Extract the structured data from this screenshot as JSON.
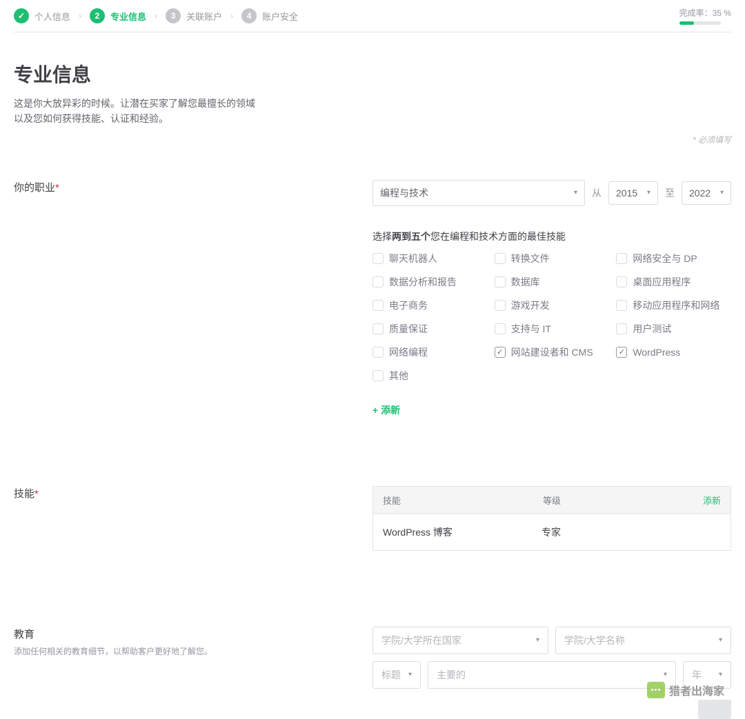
{
  "stepper": {
    "steps": [
      {
        "label": "个人信息",
        "state": "done",
        "num": "✓"
      },
      {
        "label": "专业信息",
        "state": "active",
        "num": "2"
      },
      {
        "label": "关联账户",
        "state": "idle",
        "num": "3"
      },
      {
        "label": "账户安全",
        "state": "idle",
        "num": "4"
      }
    ],
    "progress_label": "完成率：35 %",
    "progress_pct": 35
  },
  "header": {
    "title": "专业信息",
    "desc": "这是你大放异彩的时候。让潜在买家了解您最擅长的领域以及您如何获得技能、认证和经验。",
    "required_note": "* 必须填写"
  },
  "occupation": {
    "label": "你的职业",
    "select_value": "编程与技术",
    "from_label": "从",
    "from_value": "2015",
    "to_label": "至",
    "to_value": "2022",
    "skills_prompt_pre": "选择",
    "skills_prompt_bold": "两到五个",
    "skills_prompt_post": "您在编程和技术方面的最佳技能",
    "skills": [
      {
        "label": "聊天机器人",
        "checked": false
      },
      {
        "label": "转换文件",
        "checked": false
      },
      {
        "label": "网络安全与 DP",
        "checked": false
      },
      {
        "label": "数据分析和报告",
        "checked": false
      },
      {
        "label": "数据库",
        "checked": false
      },
      {
        "label": "桌面应用程序",
        "checked": false
      },
      {
        "label": "电子商务",
        "checked": false
      },
      {
        "label": "游戏开发",
        "checked": false
      },
      {
        "label": "移动应用程序和网络",
        "checked": false
      },
      {
        "label": "质量保证",
        "checked": false
      },
      {
        "label": "支持与 IT",
        "checked": false
      },
      {
        "label": "用户测试",
        "checked": false
      },
      {
        "label": "网络编程",
        "checked": false
      },
      {
        "label": "网站建设者和 CMS",
        "checked": true
      },
      {
        "label": "WordPress",
        "checked": true
      },
      {
        "label": "其他",
        "checked": false
      }
    ],
    "add_new": "+ 添新"
  },
  "skills": {
    "label": "技能",
    "header": {
      "col1": "技能",
      "col2": "等级",
      "col3": "添新"
    },
    "rows": [
      {
        "name": "WordPress 博客",
        "level": "专家"
      }
    ]
  },
  "education": {
    "label": "教育",
    "sub": "添加任何相关的教育细节，以帮助客户更好地了解您。",
    "country_placeholder": "学院/大学所在国家",
    "name_placeholder": "学院/大学名称",
    "title_placeholder": "标题",
    "major_placeholder": "主要的",
    "year_placeholder": "年"
  },
  "watermark": "猎者出海家"
}
